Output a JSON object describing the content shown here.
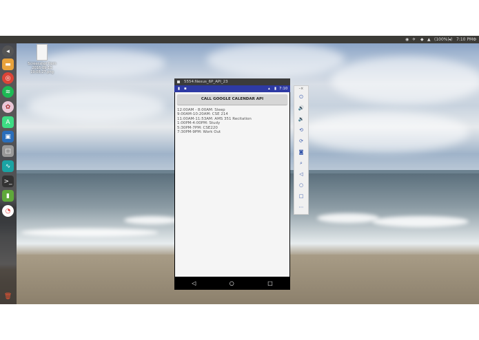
{
  "topbar": {
    "battery": "(100%)",
    "time": "7:10 PM",
    "volume_icon": "volume-icon"
  },
  "desktop_icon": {
    "label": "Screenshot from 2016-09-10 19:08:27.png"
  },
  "launcher": {
    "items": [
      "back",
      "files",
      "chrome",
      "spotify",
      "kde",
      "android-studio",
      "virtualbox",
      "disk",
      "monitor",
      "terminal",
      "android-sdk",
      "chart",
      "trash"
    ]
  },
  "emulator": {
    "window_title": "5554:Nexus_6P_API_23",
    "status_time": "7:10",
    "button_label": "CALL GOOGLE CALENDAR API",
    "events": [
      "12:00AM - 8:00AM: Sleep",
      "9:00AM-10:20AM: CSE 214",
      "11:00AM-11:53AM: AMS 351 Recitation",
      "1:00PM-4:00PM: Study",
      "5:30PM-7PM: CSE220",
      "7:30PM-9PM: Work Out"
    ]
  },
  "side_panel": {
    "items": [
      "close-icon",
      "power-icon",
      "volume-up-icon",
      "volume-down-icon",
      "rotate-left-icon",
      "rotate-right-icon",
      "camera-icon",
      "zoom-icon",
      "back-icon",
      "home-icon",
      "overview-icon",
      "more-icon"
    ]
  }
}
